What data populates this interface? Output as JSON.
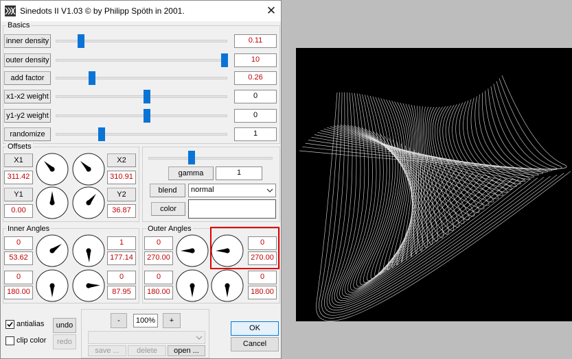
{
  "window": {
    "title": "Sinedots II V1.03 © by Philipp Spöth in 2001.",
    "close_glyph": "✕"
  },
  "basics": {
    "label": "Basics",
    "rows": [
      {
        "name": "inner density",
        "value": "0.11",
        "pos": 0.08
      },
      {
        "name": "outer density",
        "value": "10",
        "pos": 1.0
      },
      {
        "name": "add factor",
        "value": "0.26",
        "pos": 0.15
      },
      {
        "name": "x1-x2 weight",
        "value": "0",
        "pos": 0.5
      },
      {
        "name": "y1-y2 weight",
        "value": "0",
        "pos": 0.5
      },
      {
        "name": "randomize",
        "value": "1",
        "pos": 0.21
      }
    ]
  },
  "offsets": {
    "label": "Offsets",
    "x1": {
      "label": "X1",
      "value": "311.42"
    },
    "x2": {
      "label": "X2",
      "value": "310.91"
    },
    "y1": {
      "label": "Y1",
      "value": "0.00"
    },
    "y2": {
      "label": "Y2",
      "value": "36.87"
    }
  },
  "render": {
    "gamma_label": "gamma",
    "gamma_value": "1",
    "gamma_pos": 0.34,
    "blend_label": "blend",
    "blend_value": "normal",
    "color_label": "color"
  },
  "inner_angles": {
    "label": "Inner Angles",
    "a": {
      "top": "0",
      "bottom": "53.62"
    },
    "b": {
      "top": "1",
      "bottom": "177.14"
    },
    "c": {
      "top": "0",
      "bottom": "180.00"
    },
    "d": {
      "top": "0",
      "bottom": "87.95"
    }
  },
  "outer_angles": {
    "label": "Outer Angles",
    "a": {
      "top": "0",
      "bottom": "270.00"
    },
    "b": {
      "top": "0",
      "bottom": "270.00"
    },
    "c": {
      "top": "0",
      "bottom": "180.00"
    },
    "d": {
      "top": "0",
      "bottom": "180.00"
    }
  },
  "bottom": {
    "antialias_label": "antialias",
    "antialias_checked": true,
    "clip_label": "clip color",
    "clip_checked": false,
    "undo": "undo",
    "redo": "redo",
    "minus": "-",
    "zoom": "100%",
    "plus": "+",
    "save": "save ...",
    "delete": "delete",
    "open": "open ..."
  },
  "actions": {
    "ok": "OK",
    "cancel": "Cancel"
  },
  "dials": [
    {
      "id": "off1",
      "angle": 315
    },
    {
      "id": "off2",
      "angle": 315
    },
    {
      "id": "off3",
      "angle": 0
    },
    {
      "id": "off4",
      "angle": 40
    },
    {
      "id": "ia1",
      "angle": 54
    },
    {
      "id": "ia2",
      "angle": 177
    },
    {
      "id": "ia3",
      "angle": 180
    },
    {
      "id": "ia4",
      "angle": 88
    },
    {
      "id": "oa1",
      "angle": 270
    },
    {
      "id": "oa2",
      "angle": 270
    },
    {
      "id": "oa3",
      "angle": 180
    },
    {
      "id": "oa4",
      "angle": 180
    }
  ]
}
